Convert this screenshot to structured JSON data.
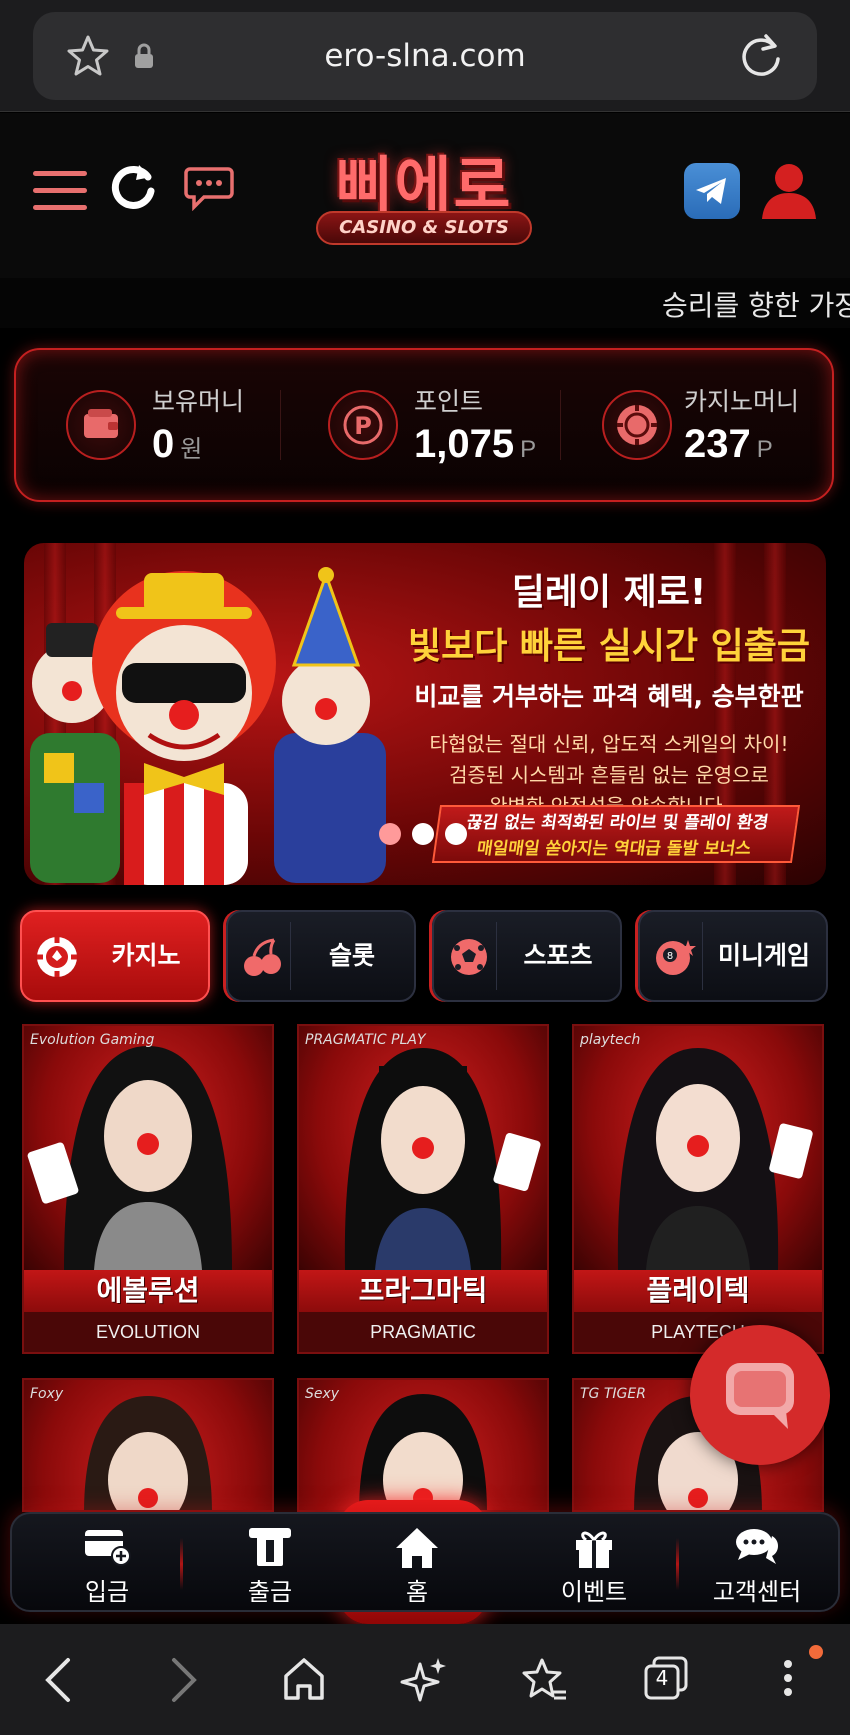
{
  "browser": {
    "url": "ero-slna.com",
    "tab_count": "4"
  },
  "header": {
    "logo_main": "삐에로",
    "logo_sub": "CASINO & SLOTS"
  },
  "marquee": {
    "text": "승리를 향한 가장"
  },
  "balance": {
    "items": [
      {
        "label": "보유머니",
        "value": "0",
        "unit": "원"
      },
      {
        "label": "포인트",
        "value": "1,075",
        "unit": "P"
      },
      {
        "label": "카지노머니",
        "value": "237",
        "unit": "P"
      }
    ]
  },
  "banner": {
    "title": "딜레이 제로!",
    "headline": "빛보다 빠른 실시간 입출금",
    "subheadline": "비교를 거부하는 파격 혜택, 승부한판",
    "desc_line1": "타협없는 절대 신뢰, 압도적 스케일의 차이!",
    "desc_line2": "검증된 시스템과 흔들림 없는 운영으로",
    "desc_line3": "완벽한 안정성을 약속합니다.",
    "ribbon_line1": "끊김 없는 최적화된 라이브 및 플레이 환경",
    "ribbon_line2": "매일매일 쏟아지는 역대급 돌발 보너스",
    "slide_index": 1,
    "slide_count": 3
  },
  "tabs": [
    {
      "label": "카지노",
      "active": true
    },
    {
      "label": "슬롯",
      "active": false
    },
    {
      "label": "스포츠",
      "active": false
    },
    {
      "label": "미니게임",
      "active": false
    }
  ],
  "games": [
    {
      "provider": "Evolution Gaming",
      "title_ko": "에볼루션",
      "title_en": "EVOLUTION"
    },
    {
      "provider": "PRAGMATIC PLAY",
      "title_ko": "프라그마틱",
      "title_en": "PRAGMATIC"
    },
    {
      "provider": "playtech",
      "title_ko": "플레이텍",
      "title_en": "PLAYTECH"
    },
    {
      "provider": "Foxy",
      "title_ko": "",
      "title_en": ""
    },
    {
      "provider": "Sexy",
      "title_ko": "",
      "title_en": ""
    },
    {
      "provider": "TG TIGER",
      "title_ko": "",
      "title_en": ""
    }
  ],
  "bottom_nav": [
    {
      "label": "입금",
      "icon": "deposit-card-icon"
    },
    {
      "label": "출금",
      "icon": "withdraw-card-icon"
    },
    {
      "label": "홈",
      "icon": "home-icon"
    },
    {
      "label": "이벤트",
      "icon": "gift-icon"
    },
    {
      "label": "고객센터",
      "icon": "chat-bubbles-icon"
    }
  ],
  "colors": {
    "accent": "#d42a2a",
    "gold": "#ffd23a",
    "notification_dot": "#f26b3a"
  }
}
